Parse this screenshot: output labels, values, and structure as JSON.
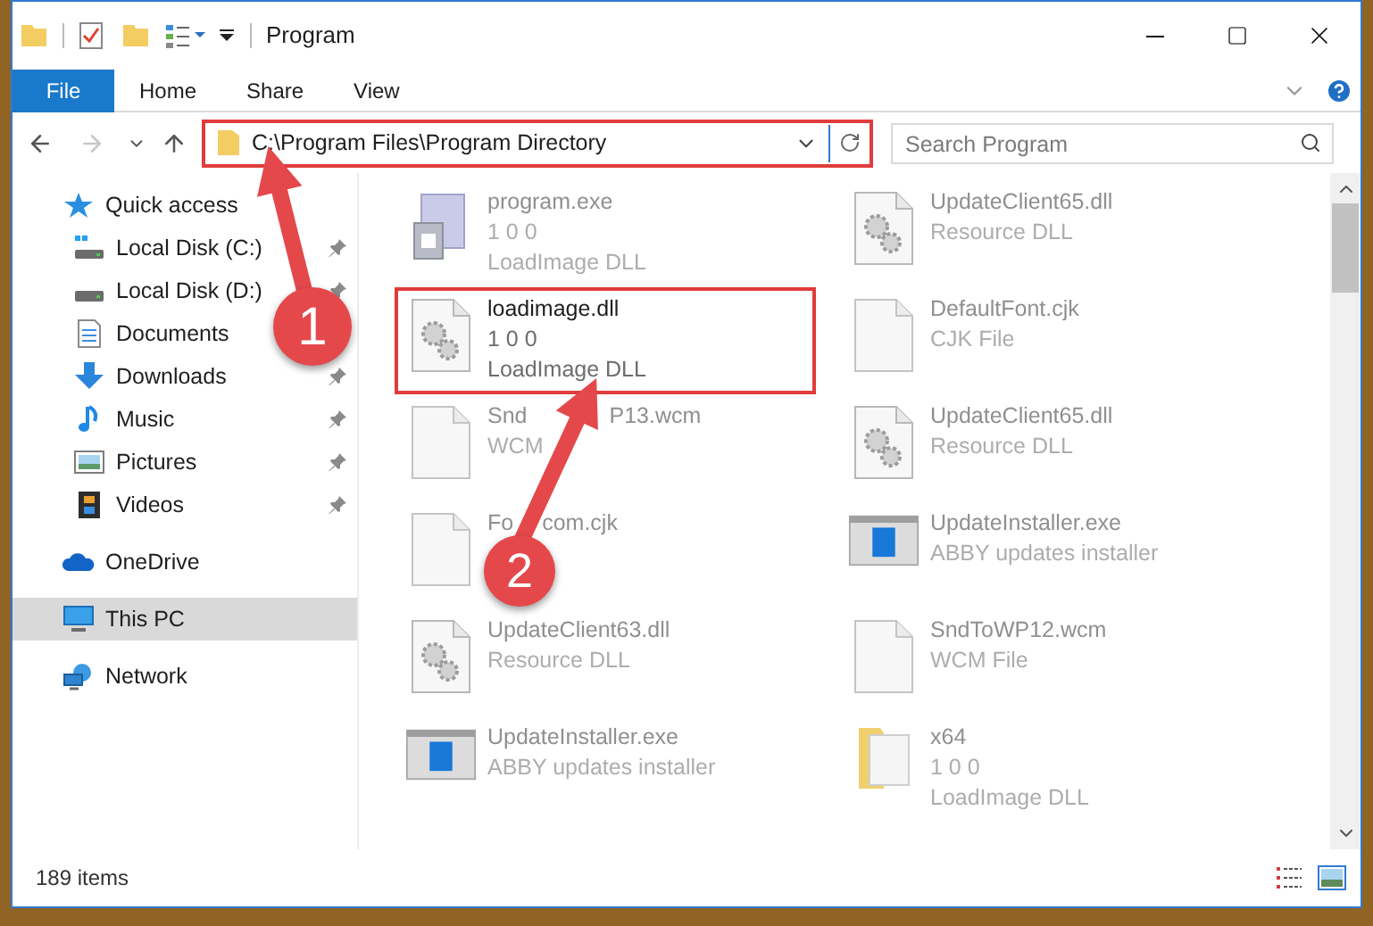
{
  "window": {
    "title": "Program"
  },
  "ribbon": {
    "file_button": "File",
    "tabs": [
      {
        "label": "Home",
        "selected": false
      },
      {
        "label": "Share",
        "selected": false
      },
      {
        "label": "View",
        "selected": false
      }
    ]
  },
  "address_bar": {
    "path": "C:\\Program Files\\Program Directory",
    "highlighted": true
  },
  "search": {
    "placeholder": "Search Program"
  },
  "sidebar": {
    "items": [
      {
        "label": "Quick access",
        "kind": "quick-access",
        "selected": false,
        "children": [
          {
            "label": "Local Disk (C:)",
            "kind": "drive-c",
            "pinned": true,
            "selected": false
          },
          {
            "label": "Local Disk (D:)",
            "kind": "drive",
            "pinned": true,
            "selected": false
          },
          {
            "label": "Documents",
            "kind": "documents",
            "selected": false
          },
          {
            "label": "Downloads",
            "kind": "downloads",
            "pinned": true,
            "selected": false
          },
          {
            "label": "Music",
            "kind": "music",
            "pinned": true,
            "selected": false
          },
          {
            "label": "Pictures",
            "kind": "pictures",
            "pinned": true,
            "selected": false
          },
          {
            "label": "Videos",
            "kind": "videos",
            "pinned": true,
            "selected": false
          }
        ]
      },
      {
        "label": "OneDrive",
        "kind": "cloud",
        "selected": false
      },
      {
        "label": "This PC",
        "kind": "pc",
        "selected": true
      },
      {
        "label": "Network",
        "kind": "network",
        "selected": false
      }
    ]
  },
  "files": {
    "columns": [
      [
        {
          "name_parts": [
            "program.exe"
          ],
          "details": [
            "1 0 0",
            "LoadImage DLL"
          ],
          "kind": "exe",
          "highlighted": false
        },
        {
          "name_parts": [
            "loadimage.dll"
          ],
          "details": [
            "1 0 0",
            "LoadImage DLL"
          ],
          "kind": "dll",
          "highlighted": true
        },
        {
          "name_parts": [
            "Snd",
            "P13.wcm"
          ],
          "details": [
            "WCM"
          ],
          "kind": "blank",
          "highlighted": false
        },
        {
          "name_parts": [
            "Fo",
            "com.cjk"
          ],
          "kind": "blank",
          "highlighted": false
        },
        {
          "name_parts": [
            "UpdateClient63.dll"
          ],
          "details": [
            "Resource DLL"
          ],
          "kind": "dll",
          "highlighted": false
        },
        {
          "name_parts": [
            "UpdateInstaller.exe"
          ],
          "details": [
            "ABBY updates installer"
          ],
          "kind": "installer",
          "highlighted": false
        }
      ],
      [
        {
          "name_parts": [
            "UpdateClient65.dll"
          ],
          "details": [
            "Resource DLL"
          ],
          "kind": "dll",
          "highlighted": false
        },
        {
          "name_parts": [
            "DefaultFont.cjk"
          ],
          "details": [
            "CJK File"
          ],
          "kind": "blank",
          "highlighted": false
        },
        {
          "name_parts": [
            "UpdateClient65.dll"
          ],
          "details": [
            "Resource DLL"
          ],
          "kind": "dll",
          "highlighted": false
        },
        {
          "name_parts": [
            "UpdateInstaller.exe"
          ],
          "details": [
            "ABBY updates installer"
          ],
          "kind": "installer",
          "highlighted": false
        },
        {
          "name_parts": [
            "SndToWP12.wcm"
          ],
          "details": [
            "WCM File"
          ],
          "kind": "blank",
          "highlighted": false
        },
        {
          "name_parts": [
            "x64"
          ],
          "details": [
            "1 0 0",
            "LoadImage DLL"
          ],
          "kind": "folder",
          "highlighted": false
        }
      ]
    ]
  },
  "status_bar": {
    "item_count": "189 items"
  },
  "callouts": [
    {
      "number": "1"
    },
    {
      "number": "2"
    }
  ]
}
